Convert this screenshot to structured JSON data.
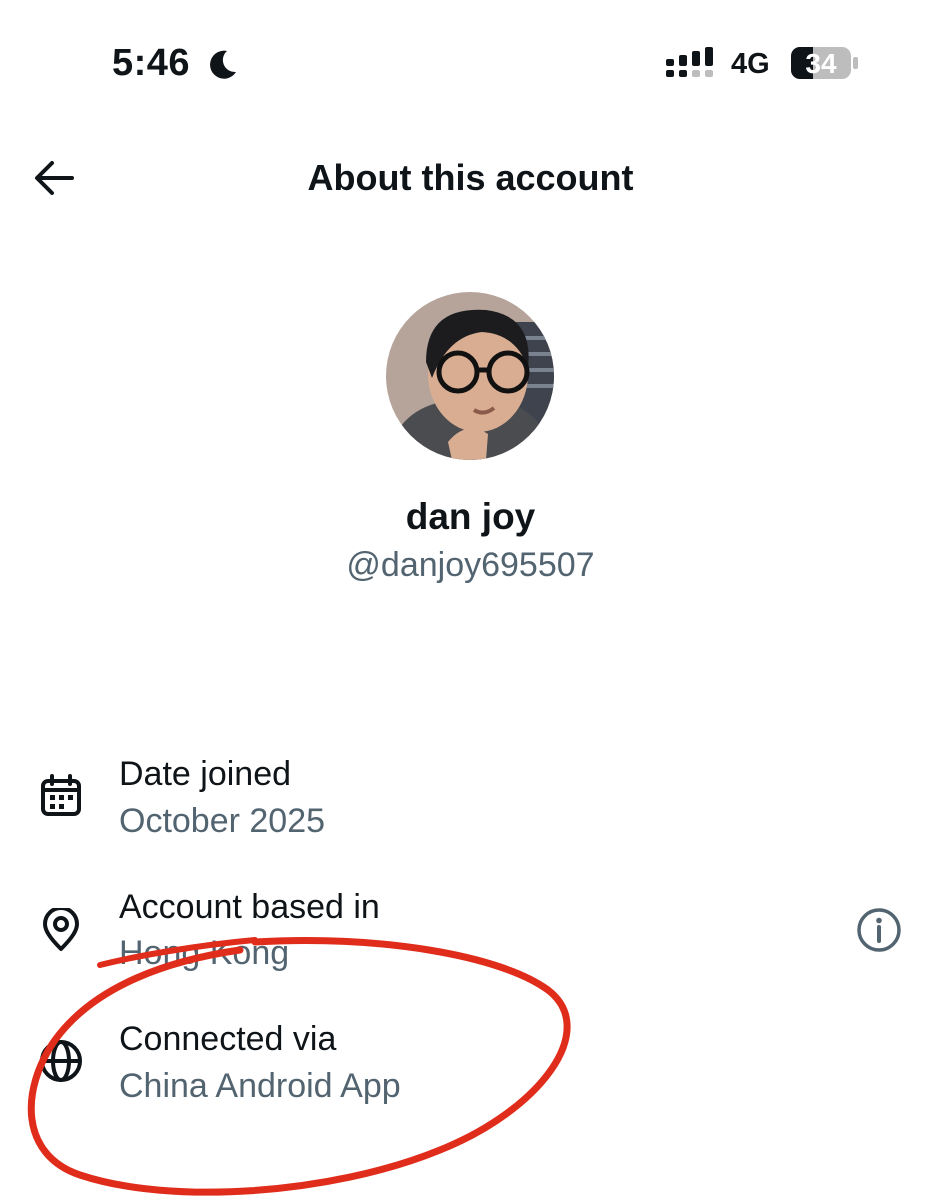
{
  "status_bar": {
    "time": "5:46",
    "network": "4G",
    "battery": "34",
    "icons": [
      "moon-icon",
      "signal-icon",
      "battery-icon"
    ]
  },
  "header": {
    "title": "About this account",
    "back_icon": "arrow-left-icon"
  },
  "profile": {
    "name": "dan joy",
    "handle": "@danjoy695507"
  },
  "details": [
    {
      "icon": "calendar-icon",
      "label": "Date joined",
      "value": "October 2025"
    },
    {
      "icon": "location-pin-icon",
      "label": "Account based in",
      "value": "Hong Kong"
    },
    {
      "icon": "globe-icon",
      "label": "Connected via",
      "value": "China Android App"
    }
  ],
  "colors": {
    "text_primary": "#0f1419",
    "text_secondary": "#536471",
    "annotation_red": "#e02d1b"
  }
}
